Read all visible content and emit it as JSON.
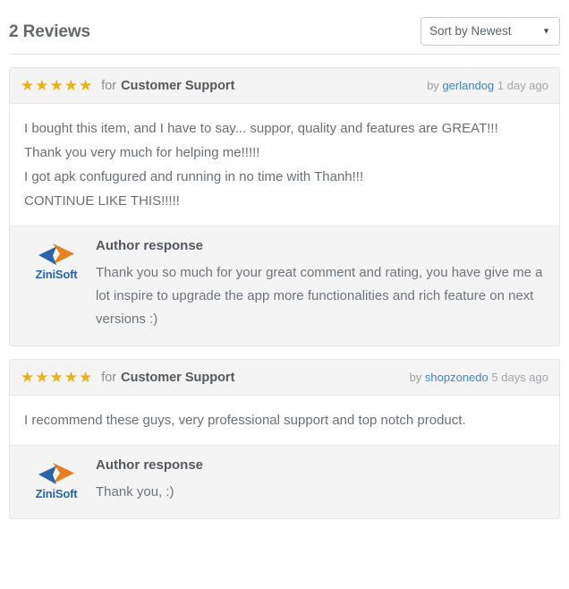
{
  "header": {
    "title": "2 Reviews",
    "sort": {
      "selected": "Sort by Newest",
      "caret_icon": "chevron-down-icon",
      "options": [
        "Sort by Newest"
      ]
    }
  },
  "colors": {
    "star": "#edb112",
    "link": "#3b86c6",
    "logo_blue": "#2a64ad",
    "logo_orange": "#e8801f",
    "header_bg": "#f4f4f4",
    "card_border": "#e4e6e8",
    "text": "#6a6f74"
  },
  "reviews": [
    {
      "rating": 5,
      "rating_stars": "★★★★★",
      "for_label": "for",
      "item_title": "Customer Support",
      "by_label": "by",
      "author": "gerlandog",
      "time": "1 day ago",
      "lines": [
        "I bought this item, and I have to say... suppor, quality and features are GREAT!!!",
        "Thank you very much for helping me!!!!!",
        "I got apk confugured and running in no time with Thanh!!!",
        "CONTINUE LIKE THIS!!!!!"
      ],
      "response": {
        "logo_name": "ZiniSoft",
        "title": "Author response",
        "text": "Thank you so much for your great comment and rating, you have give me a lot inspire to upgrade the app more functionalities and rich feature on next versions :)"
      }
    },
    {
      "rating": 5,
      "rating_stars": "★★★★★",
      "for_label": "for",
      "item_title": "Customer Support",
      "by_label": "by",
      "author": "shopzonedo",
      "time": "5 days ago",
      "lines": [
        "I recommend these guys, very professional support and top notch product."
      ],
      "response": {
        "logo_name": "ZiniSoft",
        "title": "Author response",
        "text": "Thank you, :)"
      }
    }
  ]
}
